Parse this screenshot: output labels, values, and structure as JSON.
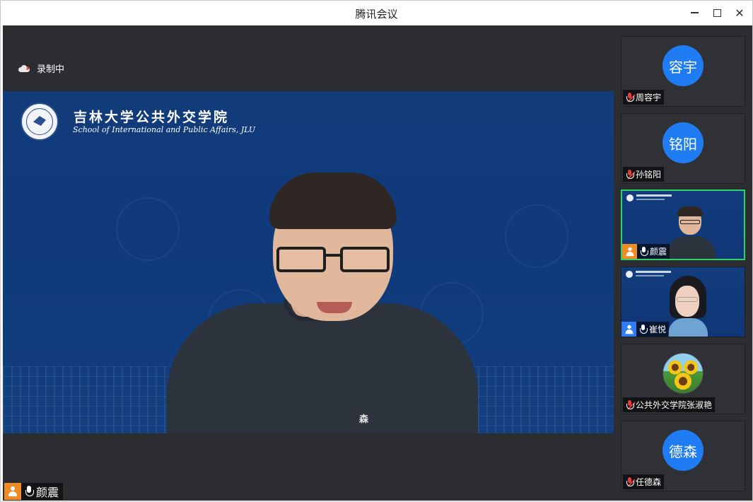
{
  "window": {
    "title": "腾讯会议"
  },
  "recording": {
    "label": "录制中",
    "icon": "cloud-record-icon",
    "dot_color": "#e0453a"
  },
  "main_video": {
    "background_color": "#123b7a",
    "school_name_cn": "吉林大学公共外交学院",
    "school_name_en": "School of International and Public Affairs, JLU",
    "chest_logo": "森",
    "speaker": {
      "name": "颜震",
      "avatar_color": "#f08a24",
      "mic": "on"
    }
  },
  "participants": [
    {
      "name": "周容宇",
      "avatar_text": "容宇",
      "mic": "muted",
      "type": "avatar"
    },
    {
      "name": "孙铭阳",
      "avatar_text": "铭阳",
      "mic": "muted",
      "type": "avatar"
    },
    {
      "name": "颜震",
      "mic": "on",
      "type": "video-male",
      "active": true,
      "avatar_color": "#f08a24"
    },
    {
      "name": "崔悦",
      "mic": "on",
      "type": "video-female",
      "avatar_color": "#2f7cf6"
    },
    {
      "name": "公共外交学院张淑艳",
      "mic": "muted",
      "type": "photo-sunflower"
    },
    {
      "name": "任德森",
      "avatar_text": "德森",
      "mic": "muted",
      "type": "avatar"
    }
  ],
  "colors": {
    "active_border": "#2bd468",
    "avatar_blue": "#1f7cf2",
    "panel_bg": "#2b2d31"
  }
}
